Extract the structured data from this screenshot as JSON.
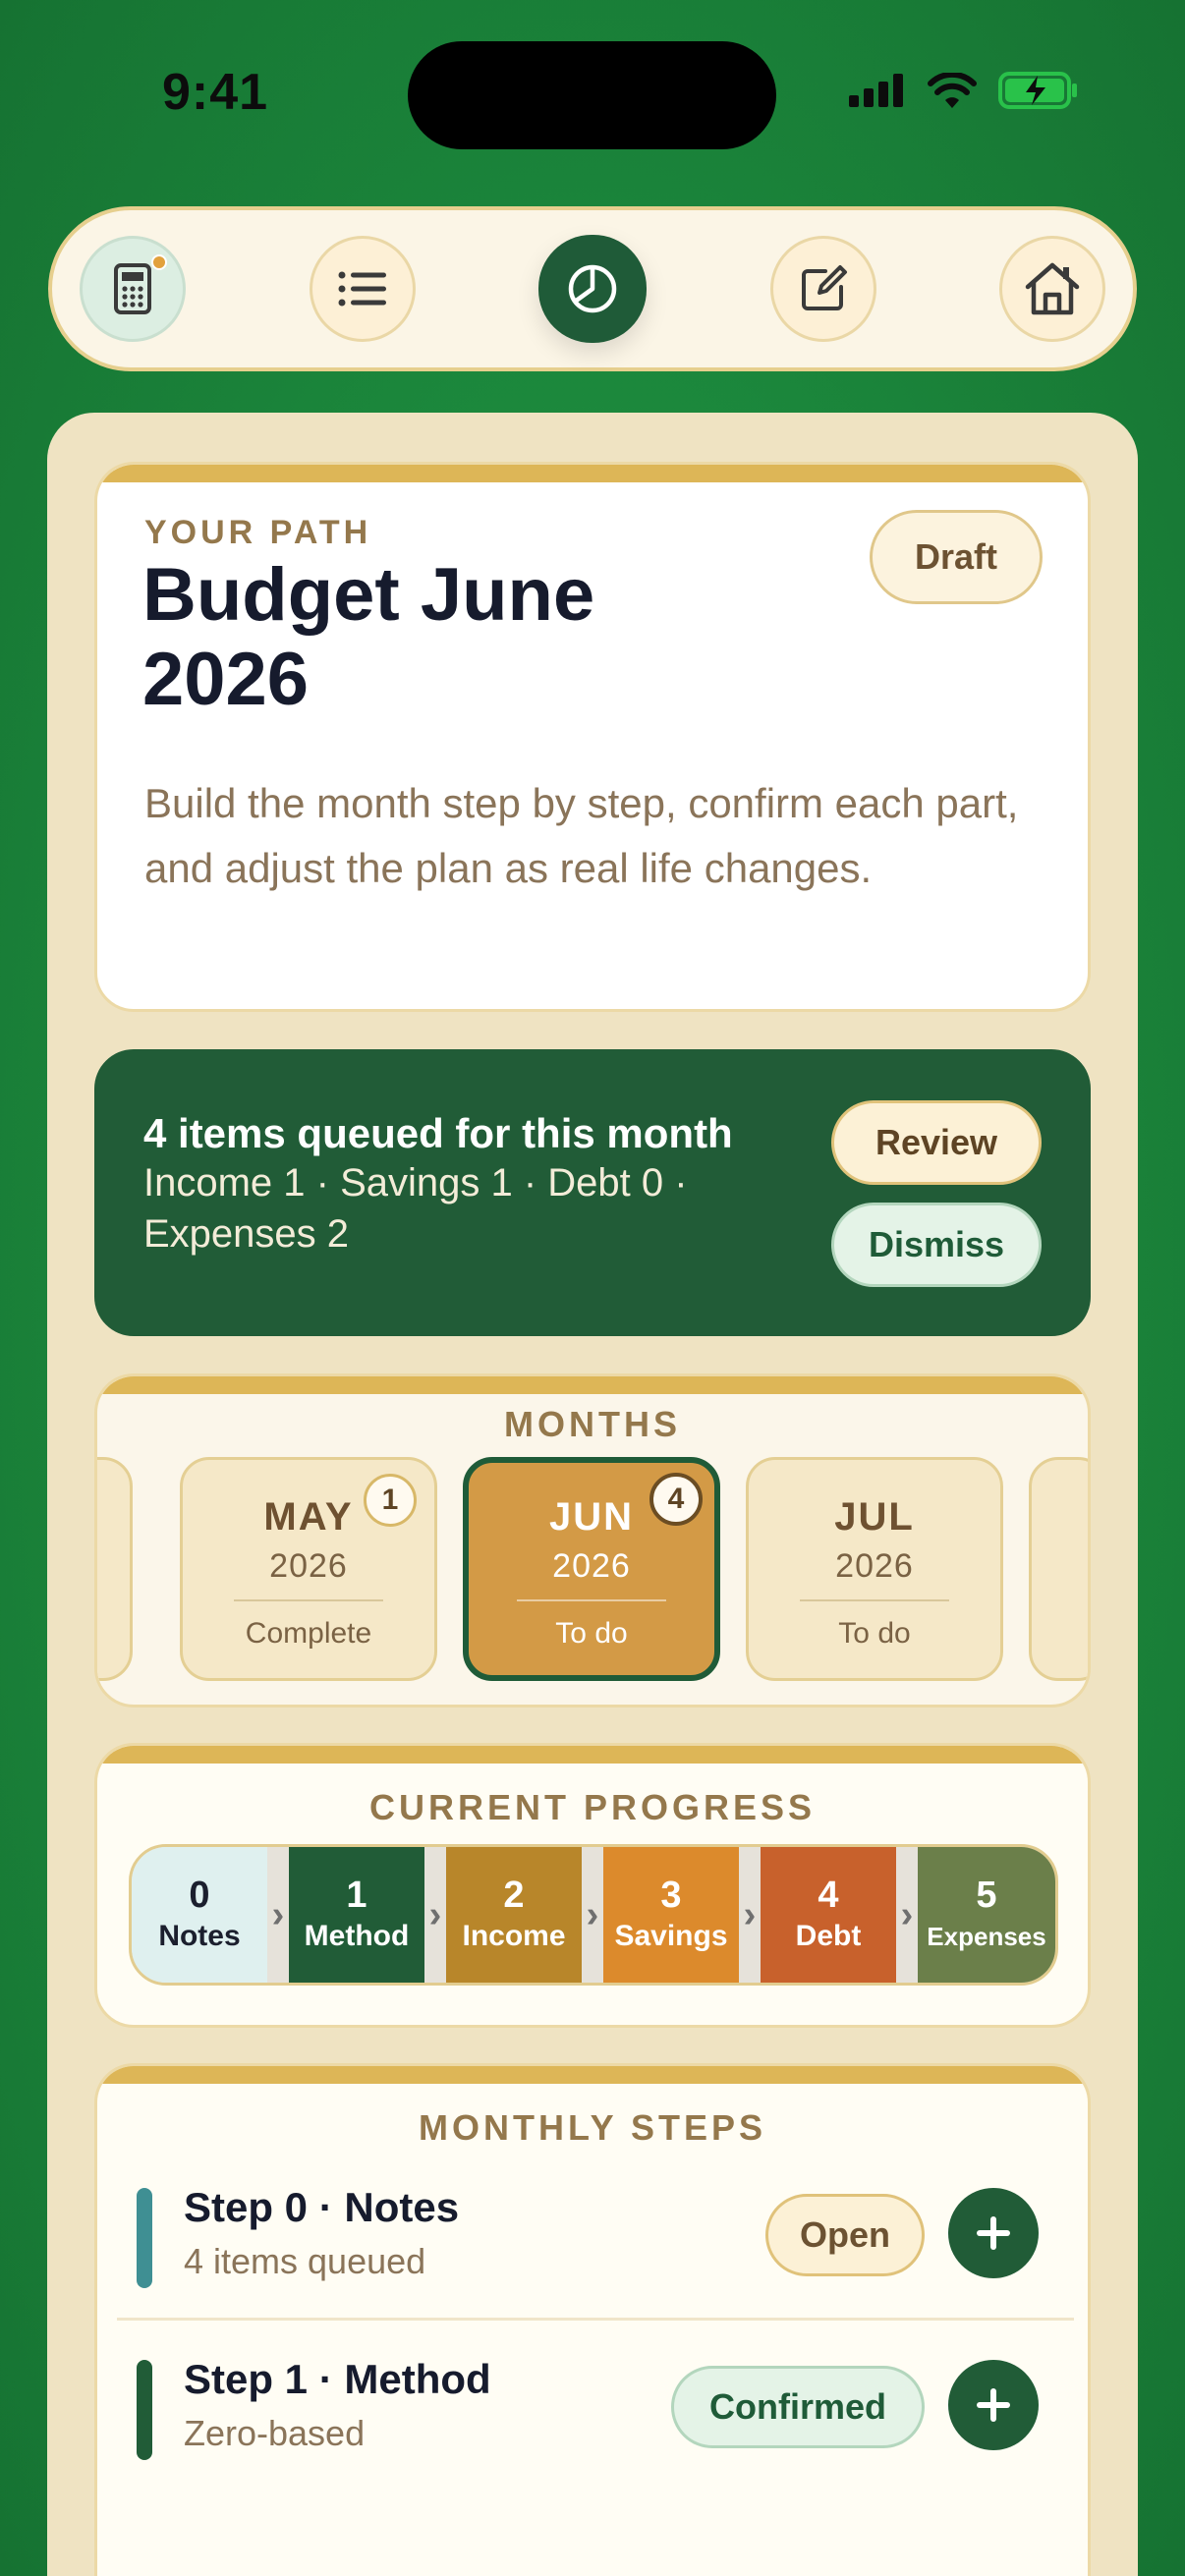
{
  "status_bar": {
    "time": "9:41"
  },
  "top_nav": {
    "items": [
      {
        "icon": "calculator-icon",
        "has_dot": true
      },
      {
        "icon": "list-icon"
      },
      {
        "icon": "pie-chart-icon",
        "active": true
      },
      {
        "icon": "edit-icon"
      },
      {
        "icon": "home-icon"
      }
    ]
  },
  "hero": {
    "eyebrow": "YOUR PATH",
    "title": "Budget June 2026",
    "description": "Build the month step by step, confirm each part, and adjust the plan as real life changes.",
    "status_label": "Draft"
  },
  "queue_banner": {
    "title": "4 items queued for this month",
    "subtitle": "Income 1 · Savings 1 · Debt 0 · Expenses 2",
    "review_label": "Review",
    "dismiss_label": "Dismiss"
  },
  "months": {
    "title": "MONTHS",
    "items": [
      {
        "name": "MAY",
        "year": "2026",
        "status": "Complete",
        "badge": "1"
      },
      {
        "name": "JUN",
        "year": "2026",
        "status": "To do",
        "badge": "4",
        "active": true
      },
      {
        "name": "JUL",
        "year": "2026",
        "status": "To do"
      }
    ]
  },
  "progress": {
    "title": "CURRENT PROGRESS",
    "steps": [
      {
        "num": "0",
        "label": "Notes",
        "color": "#dff0ef"
      },
      {
        "num": "1",
        "label": "Method",
        "color": "#215c37"
      },
      {
        "num": "2",
        "label": "Income",
        "color": "#b8862a"
      },
      {
        "num": "3",
        "label": "Savings",
        "color": "#dc8a2c"
      },
      {
        "num": "4",
        "label": "Debt",
        "color": "#c8612c"
      },
      {
        "num": "5",
        "label": "Expenses",
        "color": "#6b7f4a"
      }
    ]
  },
  "monthly_steps": {
    "title": "MONTHLY STEPS",
    "rows": [
      {
        "title": "Step 0 · Notes",
        "subtitle": "4 items queued",
        "action": "Open",
        "accent": "#3f8f93"
      },
      {
        "title": "Step 1 · Method",
        "subtitle": "Zero-based",
        "action": "Confirmed",
        "accent": "#215c37"
      }
    ]
  },
  "colors": {
    "background": "#1c8a3d",
    "brand_green": "#215c37",
    "gold": "#ddb657",
    "cream": "#efe3c2"
  }
}
